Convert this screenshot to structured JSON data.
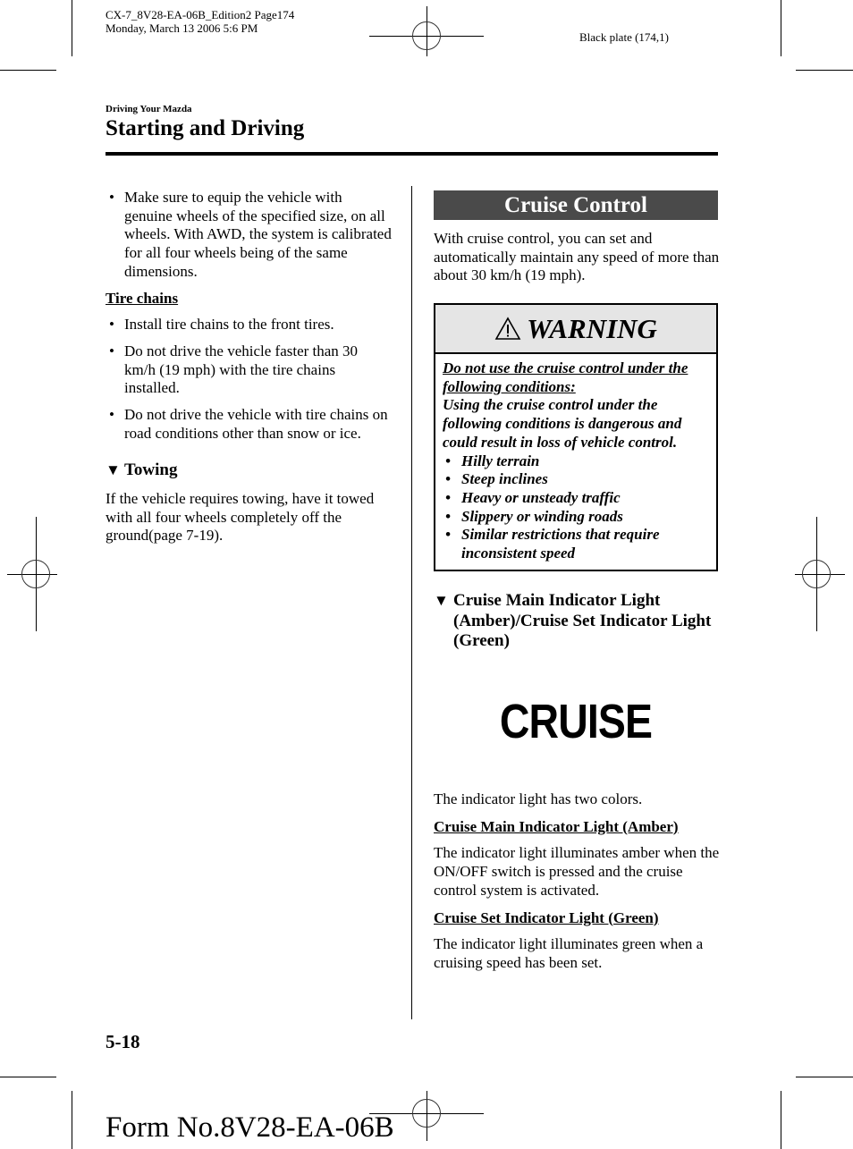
{
  "print_slug": {
    "line1": "CX-7_8V28-EA-06B_Edition2 Page174",
    "line2": "Monday, March 13 2006 5:6 PM",
    "plate": "Black plate (174,1)"
  },
  "header": {
    "chapter": "Driving Your Mazda",
    "section_title": "Starting and Driving"
  },
  "left_column": {
    "intro_bullets": [
      "Make sure to equip the vehicle with genuine wheels of the specified size, on all wheels. With AWD, the system is calibrated for all four wheels being of the same dimensions."
    ],
    "tire_chains": {
      "heading": "Tire chains",
      "bullets": [
        "Install tire chains to the front tires.",
        "Do not drive the vehicle faster than 30 km/h (19 mph) with the tire chains installed.",
        "Do not drive the vehicle with tire chains on road conditions other than snow or ice."
      ]
    },
    "towing": {
      "heading": "Towing",
      "text": "If the vehicle requires towing, have it towed with all four wheels completely off the ground(page 7-19)."
    }
  },
  "right_column": {
    "banner": "Cruise Control",
    "intro": "With cruise control, you can set and automatically maintain any speed of more than about 30 km/h (19 mph).",
    "warning": {
      "icon": "warning-triangle-icon",
      "title": "WARNING",
      "underlined_lead": "Do not use the cruise control under the following conditions:",
      "text": "Using the cruise control under the following conditions is dangerous and could result in loss of vehicle control.",
      "bullets": [
        "Hilly terrain",
        "Steep inclines",
        "Heavy or unsteady traffic",
        "Slippery or winding roads",
        "Similar restrictions that require inconsistent speed"
      ]
    },
    "indicator_section": {
      "heading": "Cruise Main Indicator Light (Amber)/Cruise Set Indicator Light (Green)",
      "indicator_symbol": "CRUISE",
      "intro": "The indicator light has two colors.",
      "amber": {
        "heading": "Cruise Main Indicator Light (Amber)",
        "text": "The indicator light illuminates amber when the ON/OFF switch is pressed and the cruise control system is activated."
      },
      "green": {
        "heading": "Cruise Set Indicator Light (Green)",
        "text": "The indicator light illuminates green when a cruising speed has been set."
      }
    }
  },
  "footer": {
    "page_number": "5-18",
    "form_number": "Form No.8V28-EA-06B"
  },
  "glyphs": {
    "bullet": "•",
    "triangle": "▼"
  }
}
